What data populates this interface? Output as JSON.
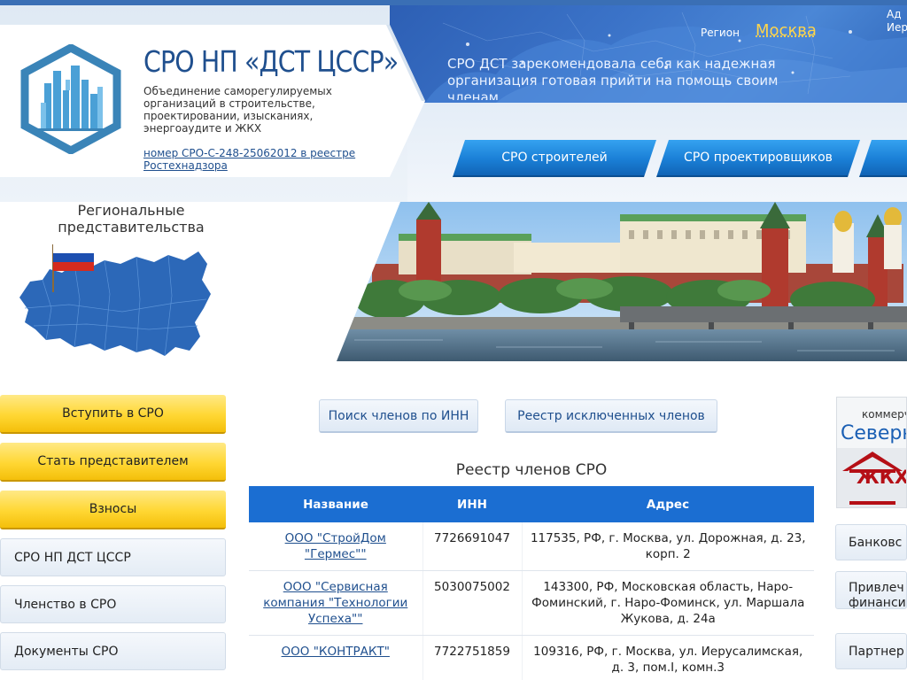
{
  "header": {
    "org_title": "СРО НП «ДСТ ЦССР»",
    "org_description": "Объединение саморегулируемых организаций в строительстве, проектировании, изысканиях, энергоаудите и ЖКХ",
    "registry_link": "номер СРО-С-248-25062012 в реестре Ростехнадзора",
    "region_label": "Регион",
    "region_value": "Москва",
    "corner_text_line1": "Ад",
    "corner_text_line2": "Иер",
    "slogan": "СРО ДСТ зарекомендовала себя как надежная организация готовая прийти на помощь своим членам"
  },
  "nav": {
    "items": [
      {
        "label": "СРО строителей"
      },
      {
        "label": "СРО проектировщиков"
      },
      {
        "label": ""
      }
    ]
  },
  "regional": {
    "title": "Региональные представительства"
  },
  "sidebar": {
    "yellow_buttons": [
      {
        "label": "Вступить в СРО"
      },
      {
        "label": "Стать представителем"
      },
      {
        "label": "Взносы"
      }
    ],
    "menu_items": [
      {
        "label": "СРО НП ДСТ ЦССР"
      },
      {
        "label": "Членство в СРО"
      },
      {
        "label": "Документы СРО"
      }
    ]
  },
  "search": {
    "inn_button": "Поиск членов по ИНН",
    "excluded_button": "Реестр исключенных членов"
  },
  "registry": {
    "title": "Реестр членов СРО",
    "columns": [
      "Название",
      "ИНН",
      "Адрес"
    ],
    "rows": [
      {
        "name": "ООО \"СтройДом \"Гермес\"\"",
        "inn": "7726691047",
        "address": "117535, РФ, г. Москва, ул. Дорожная, д. 23, корп. 2"
      },
      {
        "name": "ООО \"Сервисная компания \"Технологии Успеха\"\"",
        "inn": "5030075002",
        "address": "143300, РФ, Московская область, Наро-Фоминский, г. Наро-Фоминск, ул. Маршала Жукова, д. 24а"
      },
      {
        "name": "ООО \"КОНТРАКТ\"",
        "inn": "7722751859",
        "address": "109316, РФ, г. Москва, ул. Иерусалимская, д. 3, пом.I, комн.3"
      }
    ]
  },
  "ad": {
    "top_text": "коммерч",
    "brand_text": "Северн",
    "badge_text": "ЖКХ"
  },
  "right_menu": {
    "items": [
      {
        "label": "Банковс"
      },
      {
        "label_line1": "Привлеч",
        "label_line2": "финанси"
      },
      {
        "label": "Партнер"
      }
    ]
  },
  "colors": {
    "brand_blue": "#1f4f8e",
    "nav_blue": "#1a7fd6",
    "table_header": "#1b6ed2",
    "yellow_button": "#ffd733",
    "region_accent": "#ffd54a",
    "zhkh_red": "#b50f16"
  },
  "icons": {
    "logo": "city-skyline-hexagon-icon",
    "russia_map": "russia-map-flag-icon",
    "ad_house": "house-roof-icon"
  }
}
